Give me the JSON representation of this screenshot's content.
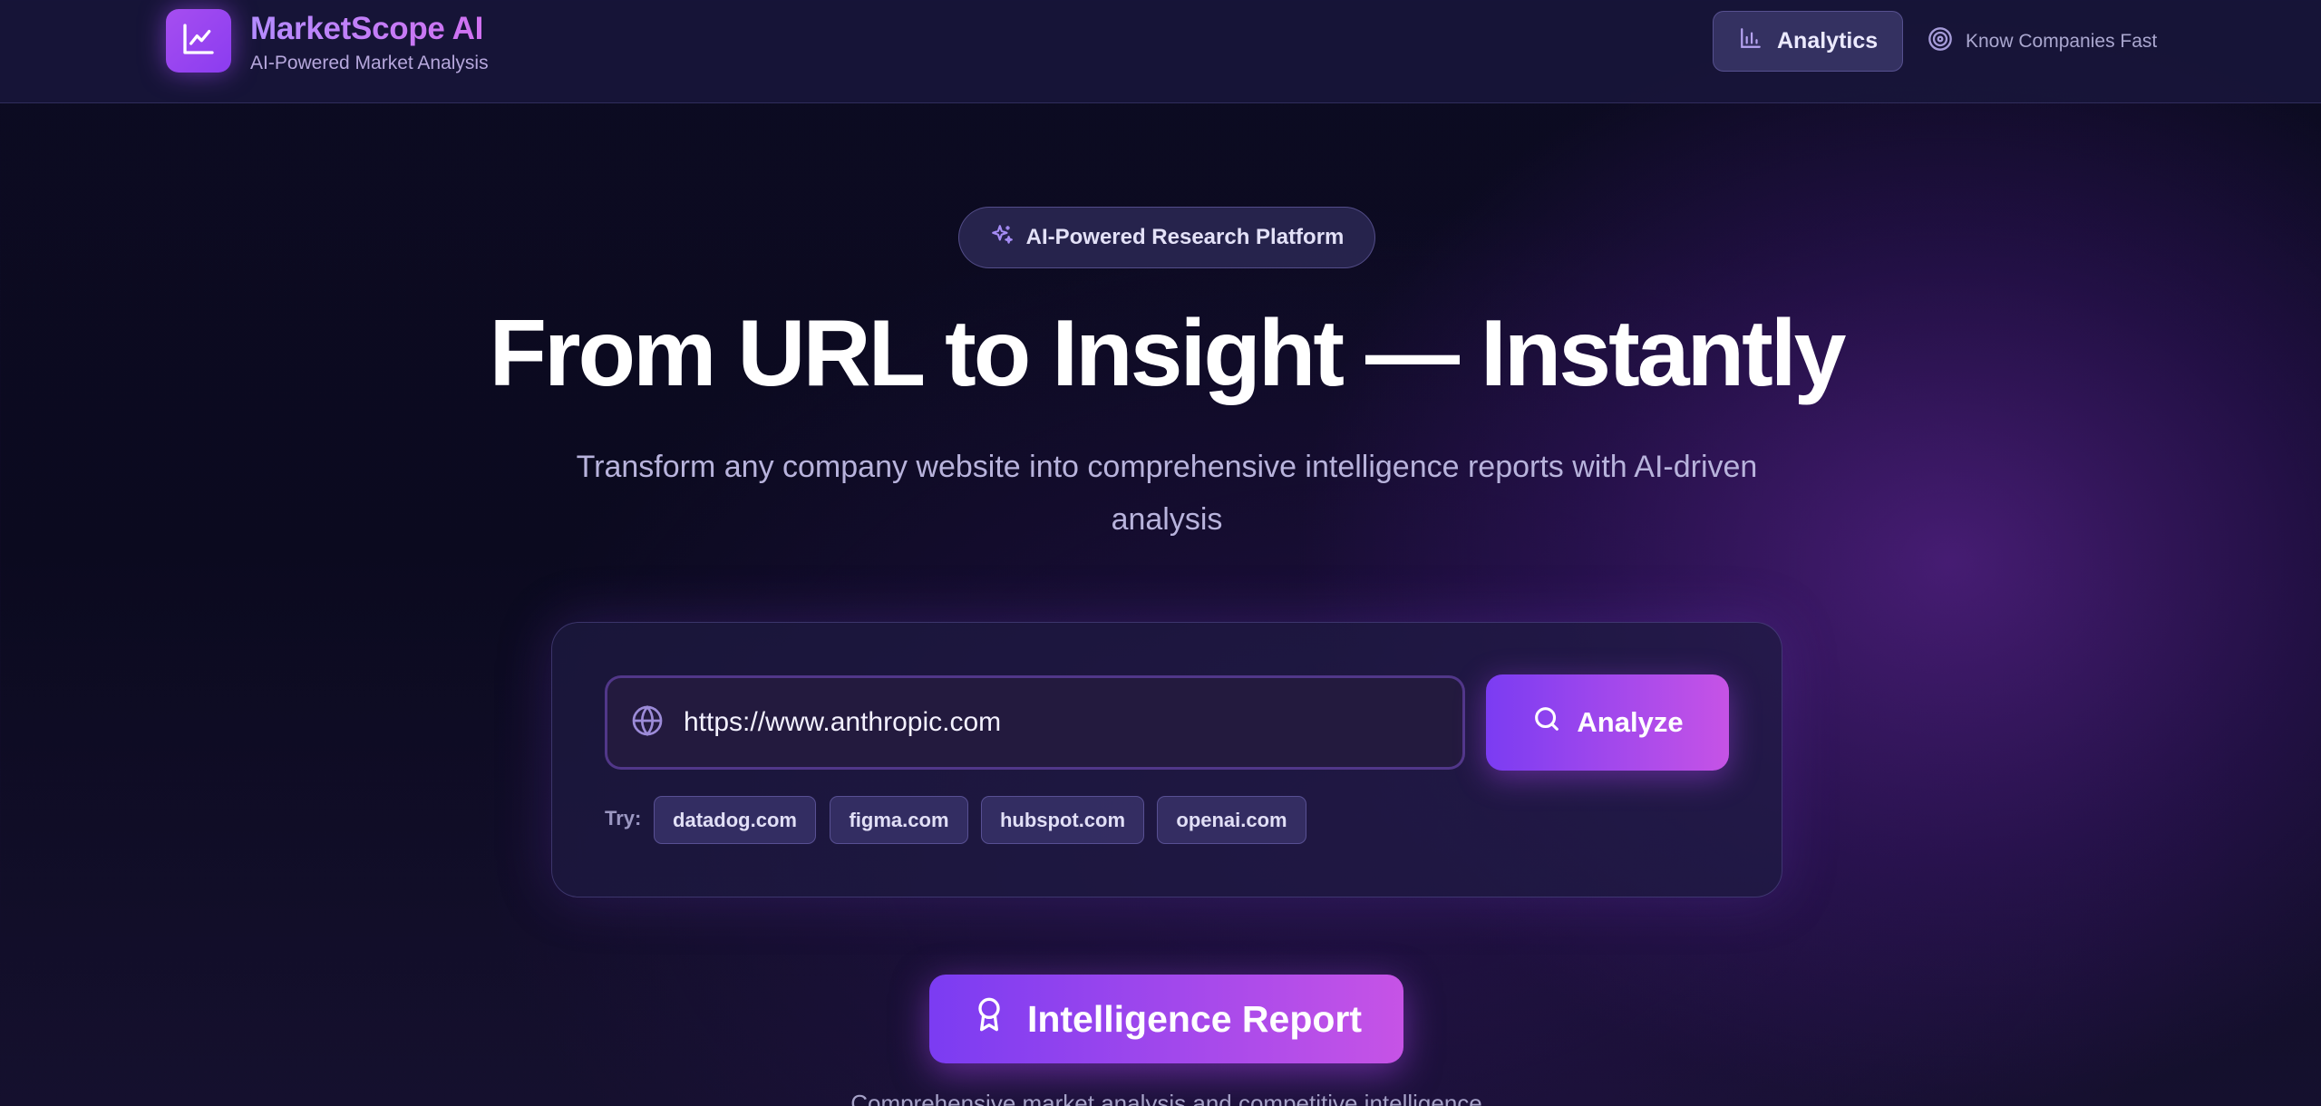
{
  "header": {
    "brand_title": "MarketScope AI",
    "brand_subtitle": "AI-Powered Market Analysis",
    "logo_icon": "line-chart-icon",
    "nav": {
      "analytics_label": "Analytics",
      "analytics_icon": "bar-chart-icon",
      "tagline": "Know Companies Fast",
      "tagline_icon": "target-icon"
    }
  },
  "hero": {
    "badge_label": "AI-Powered Research Platform",
    "badge_icon": "sparkles-icon",
    "headline": "From URL to Insight — Instantly",
    "subtitle": "Transform any company website into comprehensive intelligence reports with AI-driven analysis"
  },
  "search": {
    "url_value": "https://www.anthropic.com",
    "url_icon": "globe-icon",
    "analyze_label": "Analyze",
    "analyze_icon": "search-icon",
    "try_label": "Try:",
    "suggestions": [
      "datadog.com",
      "figma.com",
      "hubspot.com",
      "openai.com"
    ]
  },
  "report": {
    "button_label": "Intelligence Report",
    "button_icon": "award-icon",
    "caption": "Comprehensive market analysis and competitive intelligence"
  },
  "colors": {
    "accent_start": "#7b3cf2",
    "accent_end": "#c653e6",
    "background": "#0c0b22"
  }
}
